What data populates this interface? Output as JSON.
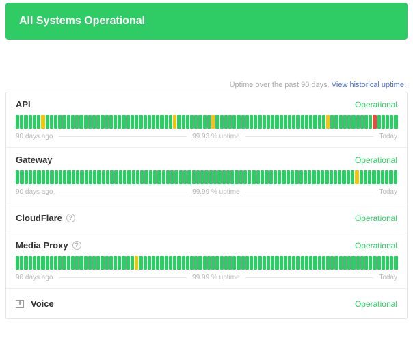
{
  "banner": {
    "title": "All Systems Operational"
  },
  "meta": {
    "text": "Uptime over the past 90 days. ",
    "link": "View historical uptime."
  },
  "legend": {
    "left": "90 days ago",
    "right": "Today"
  },
  "components": [
    {
      "name": "API",
      "status": "Operational",
      "uptime": "99.93 % uptime",
      "has_help": false,
      "has_bars": true,
      "bars": "ggggggoggggggggggggggggggggggggggggggoggggggggoggggggggggggggggggggggggggoggggggggggrggggg"
    },
    {
      "name": "Gateway",
      "status": "Operational",
      "uptime": "99.99 % uptime",
      "has_help": false,
      "has_bars": true,
      "bars": "gggggggggggggggggggggggggggggggggggggggggggggggggggggggggggggggggggggggggggggggoggggggggg"
    },
    {
      "name": "CloudFlare",
      "status": "Operational",
      "uptime": "",
      "has_help": true,
      "has_bars": false,
      "bars": ""
    },
    {
      "name": "Media Proxy",
      "status": "Operational",
      "uptime": "99.99 % uptime",
      "has_help": true,
      "has_bars": true,
      "bars": "ggggggggggggggggggggggggggggoggggggggggggggggggggggggggggggggggggggggggggggggggggggggggggg"
    },
    {
      "name": "Voice",
      "status": "Operational",
      "uptime": "",
      "has_help": false,
      "has_bars": false,
      "has_expand": true,
      "bars": ""
    }
  ]
}
